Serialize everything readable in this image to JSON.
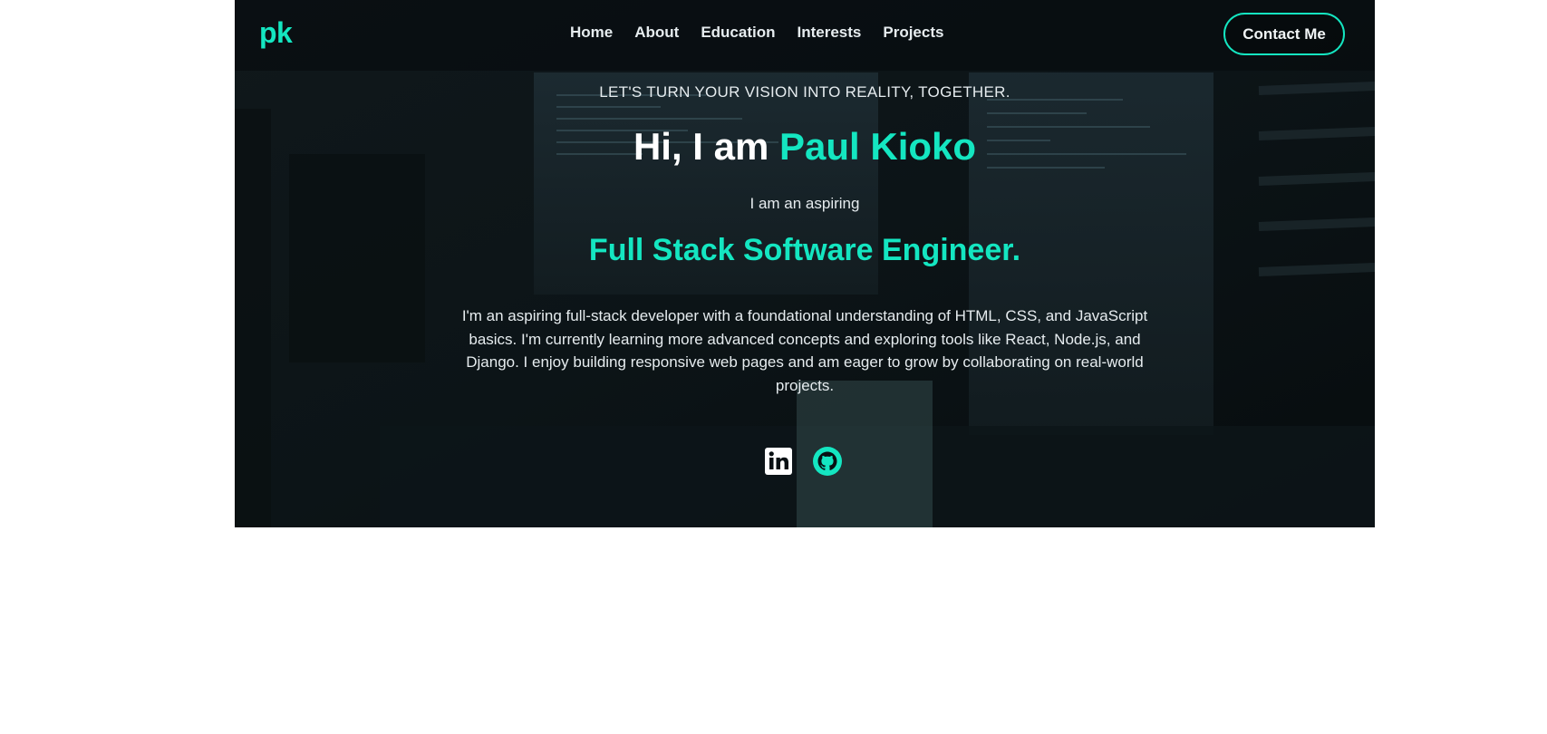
{
  "brand": {
    "logo": "pk",
    "accent_color": "#14e6c1"
  },
  "nav": {
    "links": [
      "Home",
      "About",
      "Education",
      "Interests",
      "Projects"
    ],
    "contact_label": "Contact Me"
  },
  "hero": {
    "tagline": "LET'S TURN YOUR VISION INTO REALITY, TOGETHER.",
    "greeting_prefix": "Hi, I am ",
    "name": "Paul Kioko",
    "aspiring": "I am an aspiring",
    "role": "Full Stack Software Engineer.",
    "bio": "I'm an aspiring full-stack developer with a foundational understanding of HTML, CSS, and JavaScript basics. I'm currently learning more advanced concepts and exploring tools like React, Node.js, and Django. I enjoy building responsive web pages and am eager to grow by collaborating on real-world projects."
  },
  "socials": [
    {
      "icon": "linkedin-icon"
    },
    {
      "icon": "github-icon"
    }
  ]
}
